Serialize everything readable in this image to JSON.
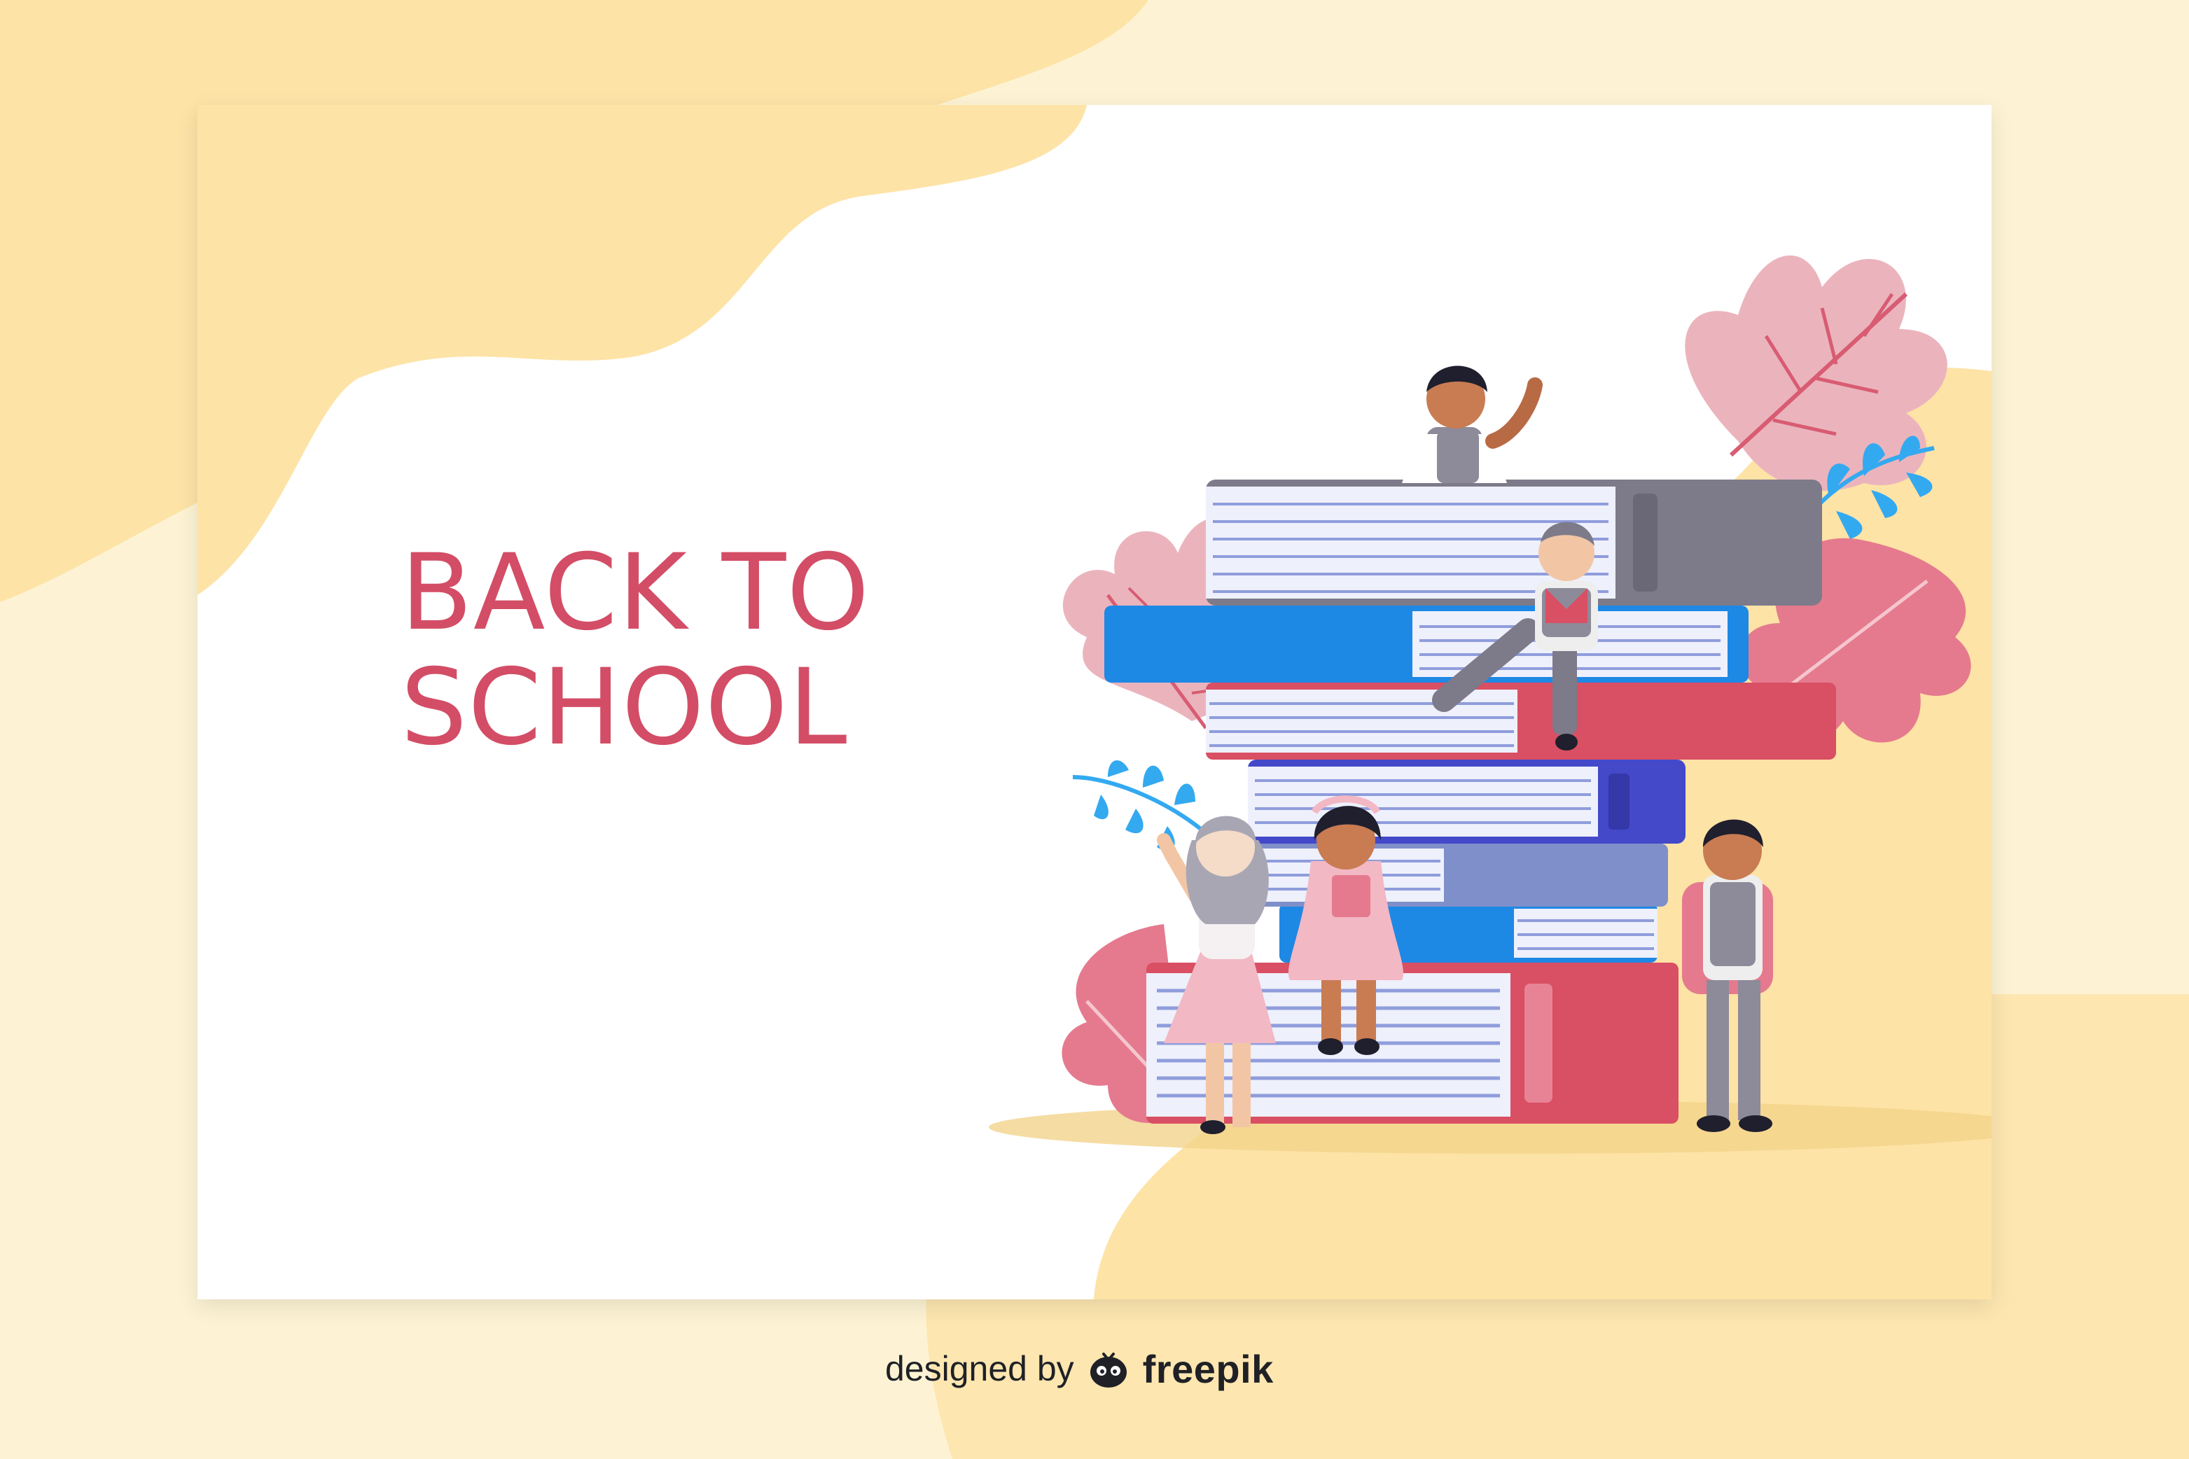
{
  "banner": {
    "headline_line1": "BACK TO",
    "headline_line2": "SCHOOL"
  },
  "attribution": {
    "prefix": "designed by",
    "brand": "freepik",
    "icon": "freepik-logo-icon"
  },
  "colors": {
    "headline": "#d34d66",
    "blob": "#fde3a6",
    "page_background": "#fdf3d4",
    "book_blue": "#1e88e5",
    "book_red": "#d94f63",
    "book_grey": "#7d7a8a",
    "book_indigo": "#4349c9",
    "leaf_pink": "#e57a8e",
    "leaf_blue": "#33a9f0"
  },
  "illustration": {
    "subject": "stack-of-books-with-students-icon"
  }
}
